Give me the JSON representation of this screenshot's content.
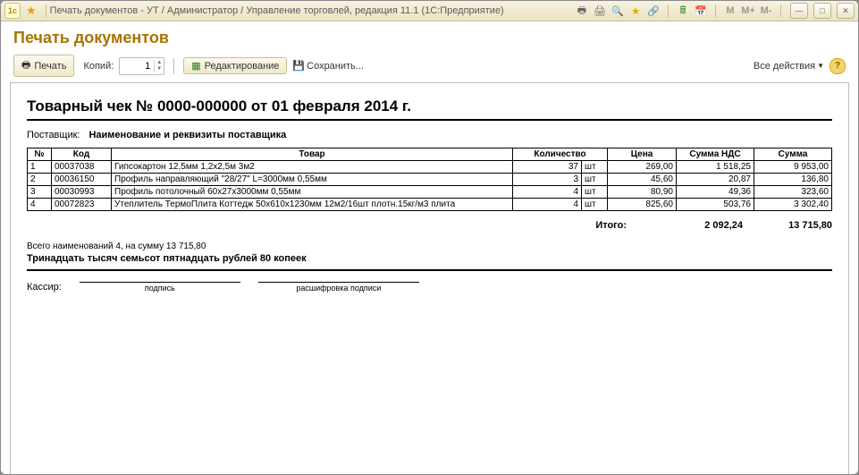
{
  "window": {
    "title": "Печать документов - УТ / Администратор / Управление торговлей, редакция 11.1  (1С:Предприятие)"
  },
  "header": {
    "title": "Печать документов"
  },
  "toolbar": {
    "print": "Печать",
    "copies_label": "Копий:",
    "copies_value": "1",
    "edit": "Редактирование",
    "save": "Сохранить...",
    "all_actions": "Все действия"
  },
  "doc": {
    "title": "Товарный чек № 0000-000000 от 01 февраля 2014 г.",
    "supplier_label": "Поставщик:",
    "supplier_value": "Наименование и реквизиты поставщика",
    "headers": {
      "num": "№",
      "code": "Код",
      "name": "Товар",
      "qty": "Количество",
      "price": "Цена",
      "vat": "Сумма НДС",
      "sum": "Сумма"
    },
    "rows": [
      {
        "n": "1",
        "code": "00037038",
        "name": "Гипсокартон 12,5мм 1,2х2,5м 3м2",
        "qty": "37",
        "unit": "шт",
        "price": "269,00",
        "vat": "1 518,25",
        "sum": "9 953,00"
      },
      {
        "n": "2",
        "code": "00036150",
        "name": "Профиль направляющий \"28/27\" L=3000мм 0,55мм",
        "qty": "3",
        "unit": "шт",
        "price": "45,60",
        "vat": "20,87",
        "sum": "136,80"
      },
      {
        "n": "3",
        "code": "00030993",
        "name": "Профиль потолочный 60х27х3000мм 0,55мм",
        "qty": "4",
        "unit": "шт",
        "price": "80,90",
        "vat": "49,36",
        "sum": "323,60"
      },
      {
        "n": "4",
        "code": "00072823",
        "name": "Утеплитель ТермоПлита Коттедж 50х610х1230мм 12м2/16шт плотн.15кг/м3 плита",
        "qty": "4",
        "unit": "шт",
        "price": "825,60",
        "vat": "503,76",
        "sum": "3 302,40"
      }
    ],
    "totals": {
      "label": "Итого:",
      "vat": "2 092,24",
      "sum": "13 715,80"
    },
    "summary_line": "Всего наименований 4, на сумму 13 715,80",
    "summary_words": "Тринадцать тысяч семьсот пятнадцать рублей 80 копеек",
    "cashier": "Кассир:",
    "sign1": "подпись",
    "sign2": "расшифровка подписи"
  }
}
